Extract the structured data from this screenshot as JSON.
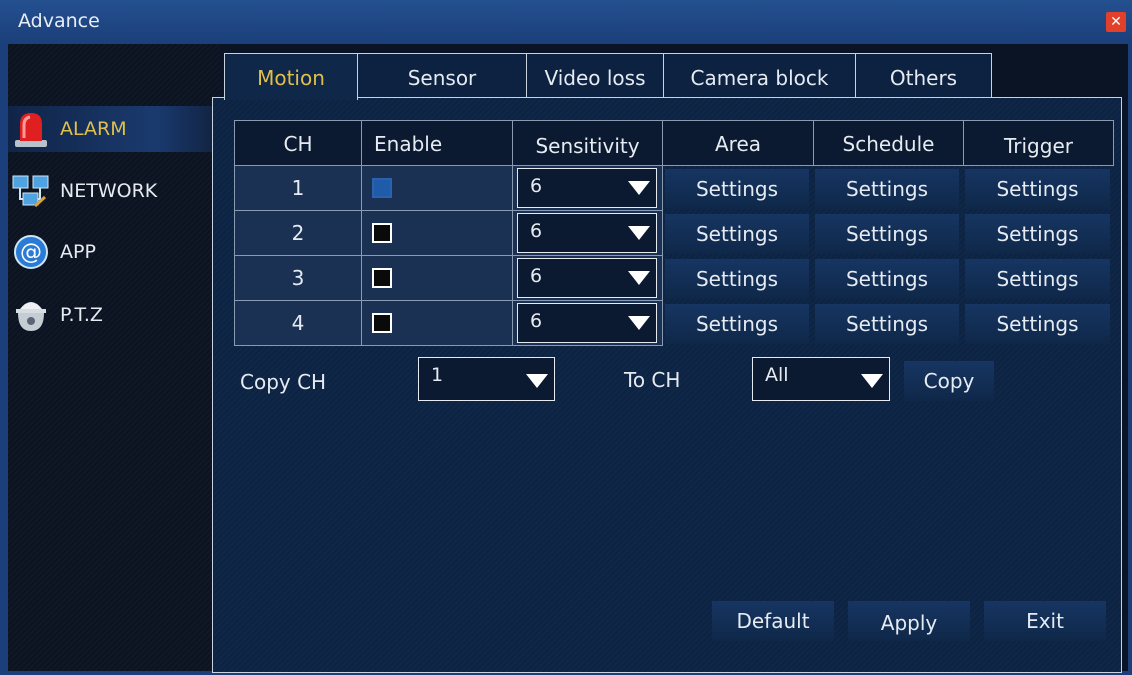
{
  "window": {
    "title": "Advance",
    "close_icon": "close-icon"
  },
  "sidebar": {
    "items": [
      {
        "label": "ALARM",
        "icon": "alarm-light-icon",
        "active": true
      },
      {
        "label": "NETWORK",
        "icon": "network-icon",
        "active": false
      },
      {
        "label": "APP",
        "icon": "at-sign-icon",
        "active": false
      },
      {
        "label": "P.T.Z",
        "icon": "ptz-camera-icon",
        "active": false
      }
    ]
  },
  "tabs": [
    {
      "label": "Motion",
      "active": true
    },
    {
      "label": "Sensor",
      "active": false
    },
    {
      "label": "Video loss",
      "active": false
    },
    {
      "label": "Camera block",
      "active": false
    },
    {
      "label": "Others",
      "active": false
    }
  ],
  "table": {
    "headers": [
      "CH",
      "Enable",
      "Sensitivity",
      "Area",
      "Schedule",
      "Trigger"
    ],
    "rows": [
      {
        "ch": "1",
        "enabled": true,
        "sensitivity": "6",
        "area": "Settings",
        "schedule": "Settings",
        "trigger": "Settings"
      },
      {
        "ch": "2",
        "enabled": false,
        "sensitivity": "6",
        "area": "Settings",
        "schedule": "Settings",
        "trigger": "Settings"
      },
      {
        "ch": "3",
        "enabled": false,
        "sensitivity": "6",
        "area": "Settings",
        "schedule": "Settings",
        "trigger": "Settings"
      },
      {
        "ch": "4",
        "enabled": false,
        "sensitivity": "6",
        "area": "Settings",
        "schedule": "Settings",
        "trigger": "Settings"
      }
    ]
  },
  "copy": {
    "copy_ch_label": "Copy CH",
    "copy_ch_value": "1",
    "to_ch_label": "To CH",
    "to_ch_value": "All",
    "copy_button": "Copy"
  },
  "footer": {
    "default_button": "Default",
    "apply_button": "Apply",
    "exit_button": "Exit"
  },
  "colors": {
    "accent": "#e0c04a",
    "titlebar": "#1b3f7a",
    "close": "#e2402a",
    "checkbox_on": "#1f5ba8"
  }
}
